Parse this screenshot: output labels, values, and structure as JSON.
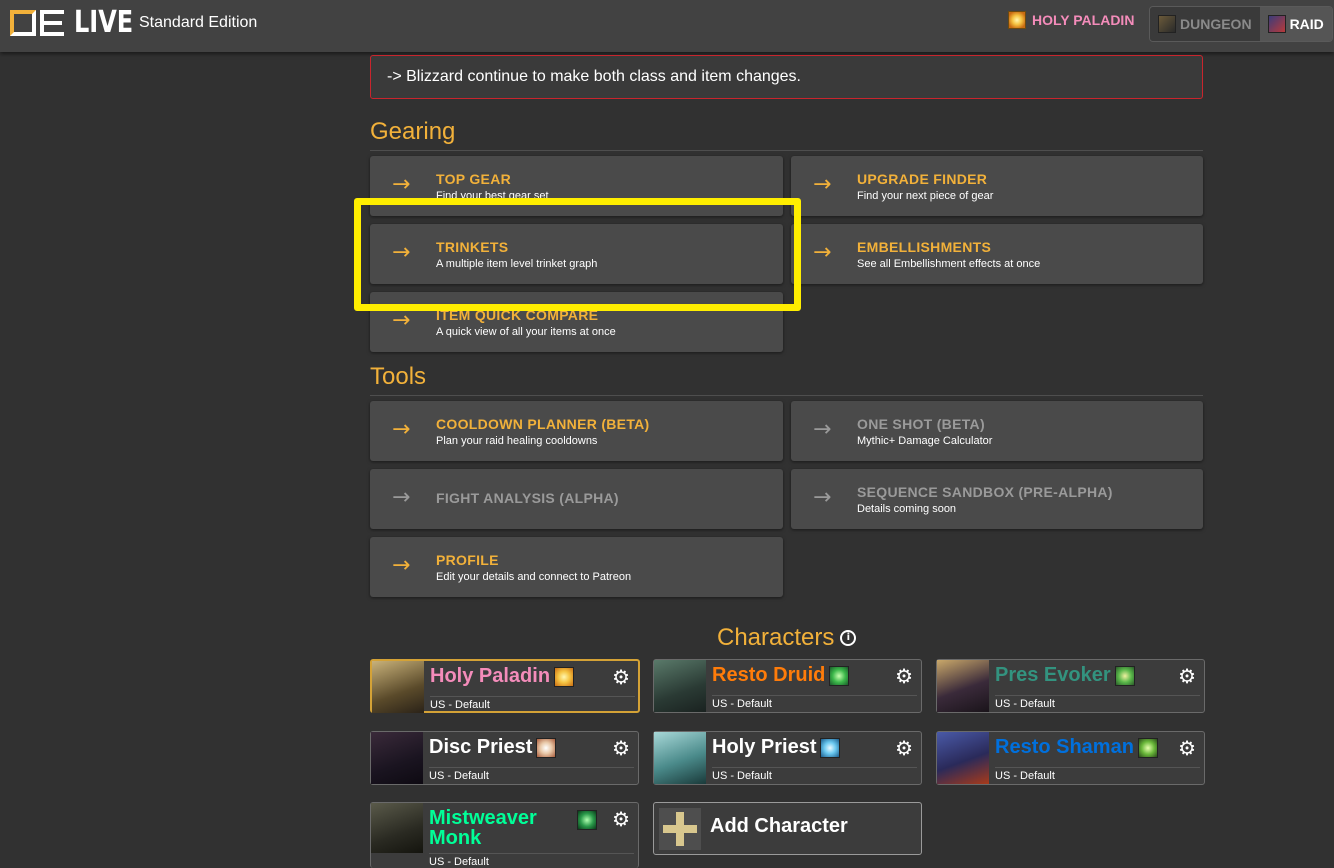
{
  "header": {
    "logo_text": "QE LIVE",
    "edition": "Standard Edition",
    "spec_label": "HOLY PALADIN",
    "modes": [
      {
        "label": "DUNGEON",
        "active": false
      },
      {
        "label": "RAID",
        "active": true
      }
    ]
  },
  "alert": {
    "text": "-> Blizzard continue to make both class and item changes."
  },
  "gearing": {
    "title": "Gearing",
    "cards": [
      {
        "title": "TOP GEAR",
        "desc": "Find your best gear set"
      },
      {
        "title": "UPGRADE FINDER",
        "desc": "Find your next piece of gear"
      },
      {
        "title": "TRINKETS",
        "desc": "A multiple item level trinket graph"
      },
      {
        "title": "EMBELLISHMENTS",
        "desc": "See all Embellishment effects at once"
      },
      {
        "title": "ITEM QUICK COMPARE",
        "desc": "A quick view of all your items at once"
      }
    ]
  },
  "tools": {
    "title": "Tools",
    "cards": [
      {
        "title": "COOLDOWN PLANNER (BETA)",
        "desc": "Plan your raid healing cooldowns",
        "disabled": false
      },
      {
        "title": "ONE SHOT (BETA)",
        "desc": "Mythic+ Damage Calculator",
        "disabled": true
      },
      {
        "title": "FIGHT ANALYSIS (ALPHA)",
        "desc": "",
        "disabled": true
      },
      {
        "title": "SEQUENCE SANDBOX (PRE-ALPHA)",
        "desc": "Details coming soon",
        "disabled": true
      },
      {
        "title": "PROFILE",
        "desc": "Edit your details and connect to Patreon",
        "disabled": false
      }
    ]
  },
  "characters": {
    "title": "Characters",
    "items": [
      {
        "name": "Holy Paladin",
        "region": "US - Default",
        "color": "#f48cba",
        "selected": true
      },
      {
        "name": "Resto Druid",
        "region": "US - Default",
        "color": "#ff7c0a",
        "selected": false
      },
      {
        "name": "Pres Evoker",
        "region": "US - Default",
        "color": "#33937f",
        "selected": false
      },
      {
        "name": "Disc Priest",
        "region": "US - Default",
        "color": "#ffffff",
        "selected": false
      },
      {
        "name": "Holy Priest",
        "region": "US - Default",
        "color": "#ffffff",
        "selected": false
      },
      {
        "name": "Resto Shaman",
        "region": "US - Default",
        "color": "#0070dd",
        "selected": false
      },
      {
        "name": "Mistweaver Monk",
        "region": "US - Default",
        "color": "#00ff98",
        "selected": false
      }
    ],
    "add_label": "Add Character"
  },
  "colors": {
    "accent": "#f2b13a",
    "alert_border": "#c9252d",
    "highlight": "#ffee00"
  }
}
